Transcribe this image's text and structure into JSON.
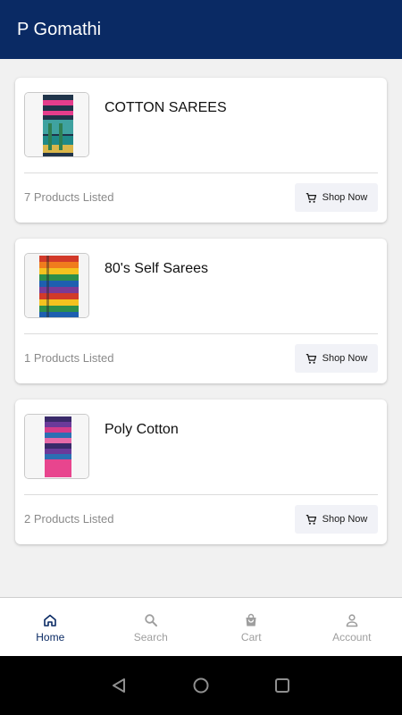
{
  "appbar": {
    "title": "P Gomathi"
  },
  "categories": [
    {
      "name": "COTTON SAREES",
      "count": "7 Products Listed",
      "button": "Shop Now",
      "image_colors": [
        "#20344a",
        "#1f8a89",
        "#3fa2a0",
        "#e53d8c",
        "#2f7f52",
        "#d9b64a"
      ]
    },
    {
      "name": "80's Self Sarees",
      "count": "1 Products Listed",
      "button": "Shop Now",
      "image_colors": [
        "#d23a2a",
        "#f07c1d",
        "#f4c21f",
        "#2d8f4a",
        "#1e5fb0",
        "#7b3b96"
      ]
    },
    {
      "name": "Poly Cotton",
      "count": "2 Products Listed",
      "button": "Shop Now",
      "image_colors": [
        "#3a2a6a",
        "#6b3a9a",
        "#d43c8a",
        "#2c6fb3",
        "#e76aa8",
        "#e8458e"
      ]
    }
  ],
  "bottom_nav": [
    {
      "label": "Home",
      "icon": "home-icon",
      "active": true
    },
    {
      "label": "Search",
      "icon": "search-icon",
      "active": false
    },
    {
      "label": "Cart",
      "icon": "bag-icon",
      "active": false
    },
    {
      "label": "Account",
      "icon": "account-icon",
      "active": false
    }
  ],
  "system_nav": [
    "back-icon",
    "home-circle-icon",
    "recents-icon"
  ],
  "colors": {
    "primary": "#0a2a64",
    "background": "#f1f1f1",
    "button_bg": "#f1f2f7",
    "muted_text": "#8a8a8a"
  }
}
